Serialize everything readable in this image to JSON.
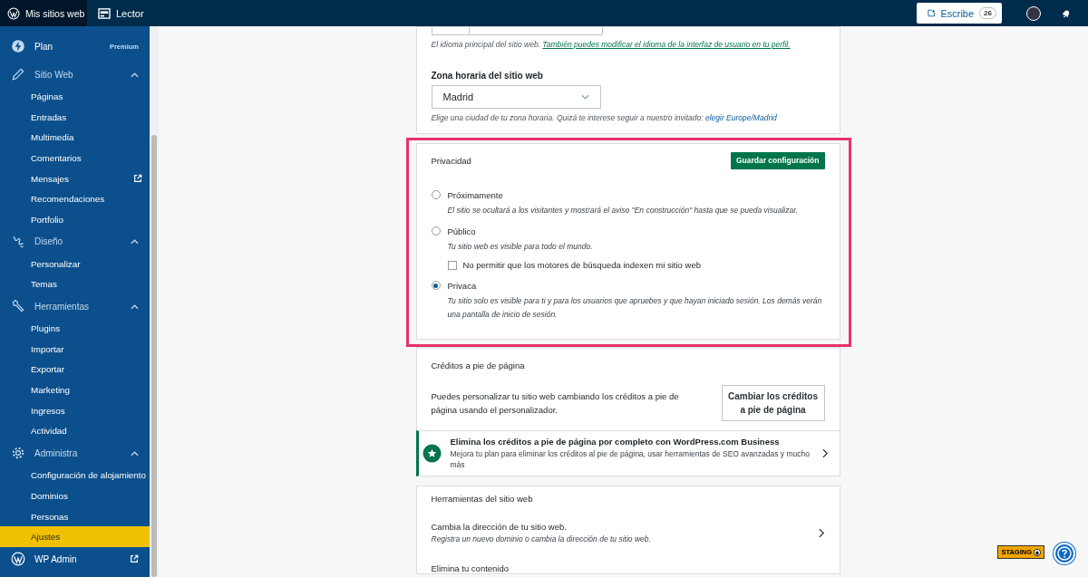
{
  "topbar": {
    "sites_label": "Mis sitios web",
    "reader_label": "Lector",
    "write_label": "Escribe",
    "write_count": "26"
  },
  "sidebar": {
    "items": [
      {
        "kind": "plan",
        "label": "Plan",
        "badge": "Premium"
      },
      {
        "kind": "section",
        "label": "Sitio Web",
        "expanded": true,
        "children": [
          {
            "label": "Páginas",
            "selected": false,
            "external": false
          },
          {
            "label": "Entradas",
            "selected": false,
            "external": false
          },
          {
            "label": "Multimedia",
            "selected": false,
            "external": false
          },
          {
            "label": "Comentarios",
            "selected": false,
            "external": false
          },
          {
            "label": "Mensajes",
            "selected": false,
            "external": true
          },
          {
            "label": "Recomendaciones",
            "selected": false,
            "external": false
          },
          {
            "label": "Portfolio",
            "selected": false,
            "external": false
          }
        ]
      },
      {
        "kind": "section",
        "label": "Diseño",
        "expanded": true,
        "children": [
          {
            "label": "Personalizar",
            "selected": false,
            "external": false
          },
          {
            "label": "Temas",
            "selected": false,
            "external": false
          }
        ]
      },
      {
        "kind": "section",
        "label": "Herramientas",
        "expanded": true,
        "children": [
          {
            "label": "Plugins",
            "selected": false,
            "external": false
          },
          {
            "label": "Importar",
            "selected": false,
            "external": false
          },
          {
            "label": "Exportar",
            "selected": false,
            "external": false
          },
          {
            "label": "Marketing",
            "selected": false,
            "external": false
          },
          {
            "label": "Ingresos",
            "selected": false,
            "external": false
          },
          {
            "label": "Actividad",
            "selected": false,
            "external": false
          }
        ]
      },
      {
        "kind": "section",
        "label": "Administra",
        "expanded": true,
        "children": [
          {
            "label": "Configuración de alojamiento",
            "selected": false,
            "external": false
          },
          {
            "label": "Dominios",
            "selected": false,
            "external": false
          },
          {
            "label": "Personas",
            "selected": false,
            "external": false
          },
          {
            "label": "Ajustes",
            "selected": true,
            "external": false
          }
        ]
      },
      {
        "kind": "link",
        "label": "WP Admin",
        "external": true
      }
    ]
  },
  "language": {
    "help": "El idioma principal del sitio web.",
    "link": "También puedes modificar el idioma de la interfaz de usuario en tu perfil."
  },
  "timezone": {
    "label": "Zona horaria del sitio web",
    "value": "Madrid",
    "help": "Elige una ciudad de tu zona horaria. Quizá te interese seguir a nuestro invitado:",
    "link": "elegir Europe/Madrid"
  },
  "privacy": {
    "title": "Privacidad",
    "button": "Guardar configuración",
    "options": [
      {
        "label": "Próximamente",
        "description": "El sitio se ocultará a los visitantes y mostrará el aviso \"En construcción\" hasta que se pueda visualizar.",
        "selected": false
      },
      {
        "label": "Público",
        "description": "Tu sitio web es visible para todo el mundo.",
        "selected": false,
        "checkbox": {
          "label": "No permitir que los motores de búsqueda indexen mi sitio web",
          "checked": false
        }
      },
      {
        "label": "Privaca",
        "description": "Tu sitio solo es visible para ti y para los usuarios que apruebes y que hayan iniciado sesión. Los demás verán una pantalla de inicio de sesión.",
        "selected": true
      }
    ]
  },
  "footer_credits": {
    "title": "Créditos a pie de página",
    "text": "Puedes personalizar tu sitio web cambiando los créditos a pie de página usando el personalizador.",
    "button": "Cambiar los créditos a pie de página"
  },
  "upsell": {
    "title": "Elimina los créditos a pie de página por completo con WordPress.com Business",
    "text": "Mejora tu plan para eliminar los créditos al pie de página, usar herramientas de SEO avanzadas y mucho más"
  },
  "site_tools": {
    "title": "Herramientas del sitio web",
    "items": [
      {
        "title": "Cambia la dirección de tu sitio web.",
        "description": "Registra un nuevo dominio o cambia la dirección de tu sitio web."
      },
      {
        "title": "Elimina tu contenido"
      }
    ]
  },
  "staging_badge": "STAGING"
}
